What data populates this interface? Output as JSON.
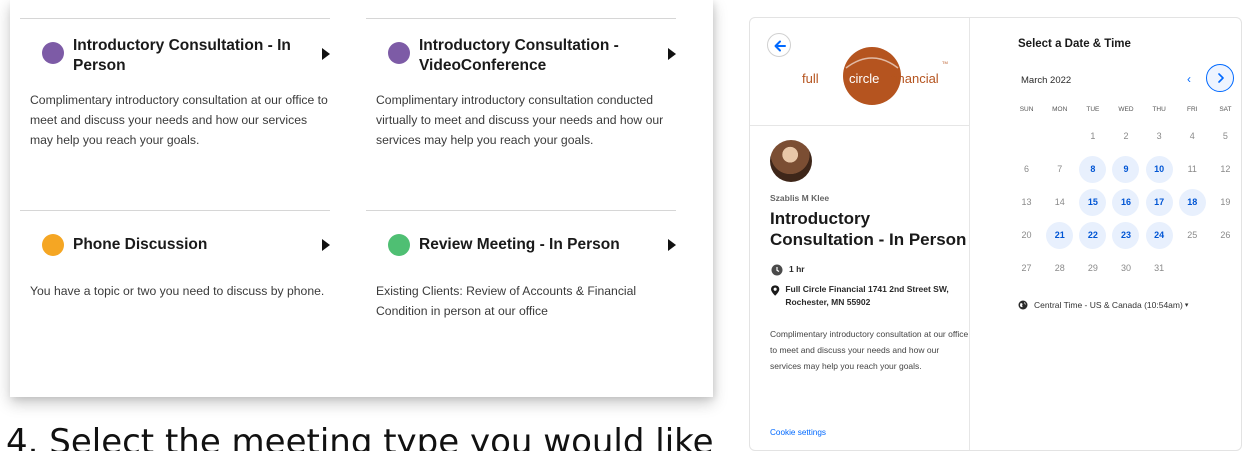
{
  "event_types": [
    {
      "name": "Introductory Consultation - In Person",
      "color": "#7d5ba6",
      "description": "Complimentary introductory consultation at our office to meet and discuss your needs and how our services may help you reach your goals."
    },
    {
      "name": "Introductory Consultation - VideoConference",
      "color": "#7d5ba6",
      "description": "Complimentary introductory consultation conducted virtually to meet and discuss your needs and how our services may help you reach your goals."
    },
    {
      "name": "Phone Discussion",
      "color": "#f5a623",
      "description": "You have a topic or two you need to discuss by phone."
    },
    {
      "name": "Review Meeting - In Person",
      "color": "#4fbf73",
      "description": "Existing Clients: Review of Accounts & Financial Condition in person at our office"
    }
  ],
  "step_heading": "4. Select the meeting type you would like",
  "widget": {
    "logo": {
      "word_left": "full",
      "word_circle": "circle",
      "word_right": "financial",
      "trademark": "TM",
      "brand_color": "#b5541f"
    },
    "host": "Szablis M Klee",
    "event_title": "Introductory Consultation - In Person",
    "duration": "1 hr",
    "location": "Full Circle Financial 1741 2nd Street SW, Rochester, MN 55902",
    "description": "Complimentary introductory consultation at our office to meet and discuss your needs and how our services may help you reach your goals.",
    "cookie_settings": "Cookie settings",
    "select_title": "Select a Date & Time",
    "month": "March 2022",
    "weekdays": [
      "SUN",
      "MON",
      "TUE",
      "WED",
      "THU",
      "FRI",
      "SAT"
    ],
    "leading_blanks": 2,
    "days": [
      {
        "d": "1",
        "a": false
      },
      {
        "d": "2",
        "a": false
      },
      {
        "d": "3",
        "a": false
      },
      {
        "d": "4",
        "a": false
      },
      {
        "d": "5",
        "a": false
      },
      {
        "d": "6",
        "a": false
      },
      {
        "d": "7",
        "a": false
      },
      {
        "d": "8",
        "a": true
      },
      {
        "d": "9",
        "a": true
      },
      {
        "d": "10",
        "a": true
      },
      {
        "d": "11",
        "a": false
      },
      {
        "d": "12",
        "a": false
      },
      {
        "d": "13",
        "a": false
      },
      {
        "d": "14",
        "a": false
      },
      {
        "d": "15",
        "a": true
      },
      {
        "d": "16",
        "a": true
      },
      {
        "d": "17",
        "a": true
      },
      {
        "d": "18",
        "a": true
      },
      {
        "d": "19",
        "a": false
      },
      {
        "d": "20",
        "a": false
      },
      {
        "d": "21",
        "a": true
      },
      {
        "d": "22",
        "a": true
      },
      {
        "d": "23",
        "a": true
      },
      {
        "d": "24",
        "a": true
      },
      {
        "d": "25",
        "a": false
      },
      {
        "d": "26",
        "a": false
      },
      {
        "d": "27",
        "a": false
      },
      {
        "d": "28",
        "a": false
      },
      {
        "d": "29",
        "a": false
      },
      {
        "d": "30",
        "a": false
      },
      {
        "d": "31",
        "a": false
      }
    ],
    "timezone": "Central Time - US & Canada (10:54am)",
    "accent": "#0069ff"
  }
}
